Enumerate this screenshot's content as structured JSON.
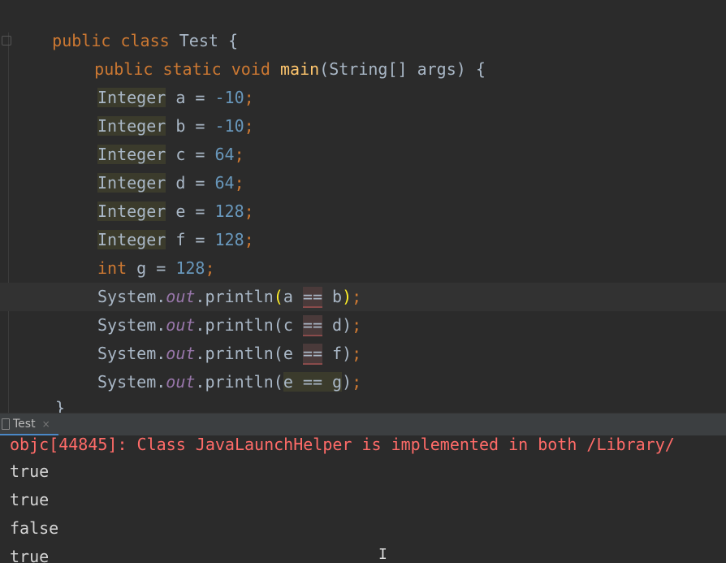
{
  "run_tab": {
    "label": "Test",
    "close": "×"
  },
  "code": {
    "l1": {
      "kw1": "public",
      "kw2": "class",
      "name": "Test",
      "brace": "{"
    },
    "l2": {
      "kw1": "public",
      "kw2": "static",
      "kw3": "void",
      "method": "main",
      "params": "(String[] args)",
      "brace": "{"
    },
    "declarations": [
      {
        "type": "Integer",
        "name": "a",
        "value": "-10"
      },
      {
        "type": "Integer",
        "name": "b",
        "value": "-10"
      },
      {
        "type": "Integer",
        "name": "c",
        "value": "64"
      },
      {
        "type": "Integer",
        "name": "d",
        "value": "64"
      },
      {
        "type": "Integer",
        "name": "e",
        "value": "128"
      },
      {
        "type": "Integer",
        "name": "f",
        "value": "128"
      },
      {
        "type": "int",
        "name": "g",
        "value": "128"
      }
    ],
    "prints": [
      {
        "left": "a",
        "right": "b"
      },
      {
        "left": "c",
        "right": "d"
      },
      {
        "left": "e",
        "right": "f"
      },
      {
        "left": "e",
        "right": "g"
      }
    ],
    "system": "System",
    "out": "out",
    "println": "println",
    "eq": "==",
    "closing": "}"
  },
  "console": {
    "error_line": "objc[44845]: Class JavaLaunchHelper is implemented in both /Library/",
    "outputs": [
      "true",
      "true",
      "false",
      "true"
    ]
  }
}
